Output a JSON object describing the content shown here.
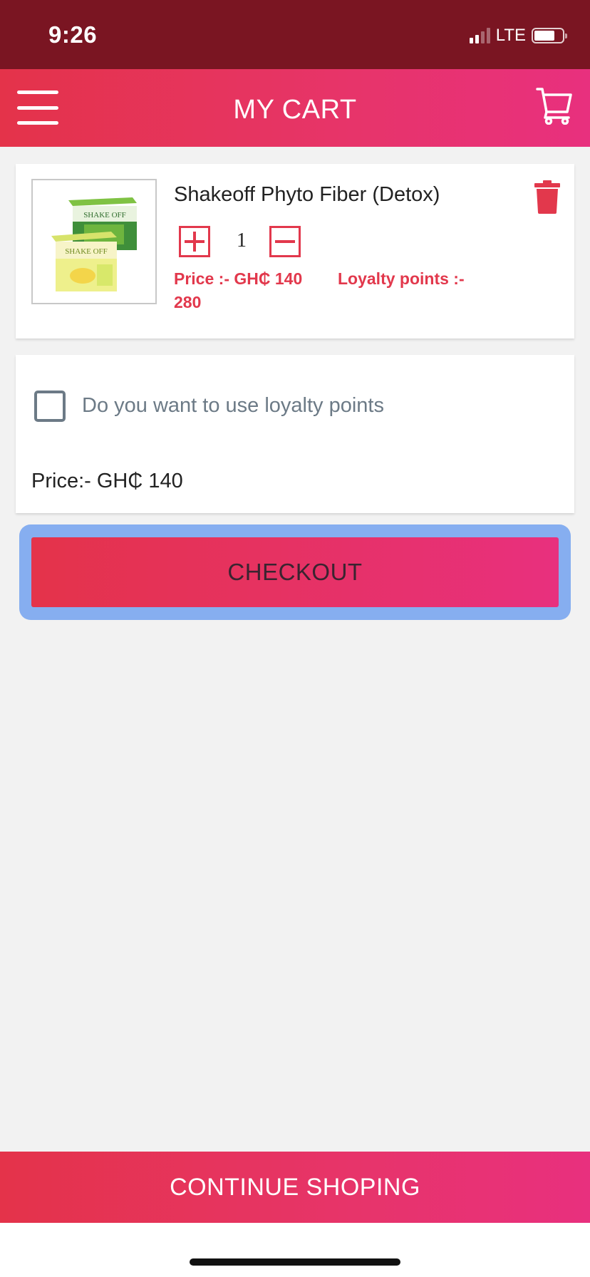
{
  "status_bar": {
    "time": "9:26",
    "network": "LTE",
    "signal_bars_filled": 2,
    "signal_bars_total": 4,
    "battery_level": 0.6
  },
  "header": {
    "title": "MY CART",
    "menu_icon": "hamburger-menu-icon",
    "cart_icon": "shopping-cart-icon"
  },
  "cart": {
    "items": [
      {
        "name": "Shakeoff Phyto Fiber (Detox)",
        "quantity": "1",
        "price_label": "Price :- GH₵ 140",
        "loyalty_label": "Loyalty points :-",
        "loyalty_value": "280",
        "image_icon": "product-box-image",
        "image_text": "SHAKE OFF"
      }
    ]
  },
  "summary": {
    "loyalty_checkbox_label": "Do you want to use loyalty points",
    "loyalty_checked": false,
    "total_price": "Price:- GH₵ 140"
  },
  "actions": {
    "checkout_label": "CHECKOUT",
    "continue_label": "CONTINUE SHOPING"
  },
  "colors": {
    "status_bar_bg": "#7a1522",
    "accent": "#e4334a",
    "accent_end": "#e8307e",
    "focus_ring": "#86aef0",
    "page_bg": "#f2f2f2"
  }
}
